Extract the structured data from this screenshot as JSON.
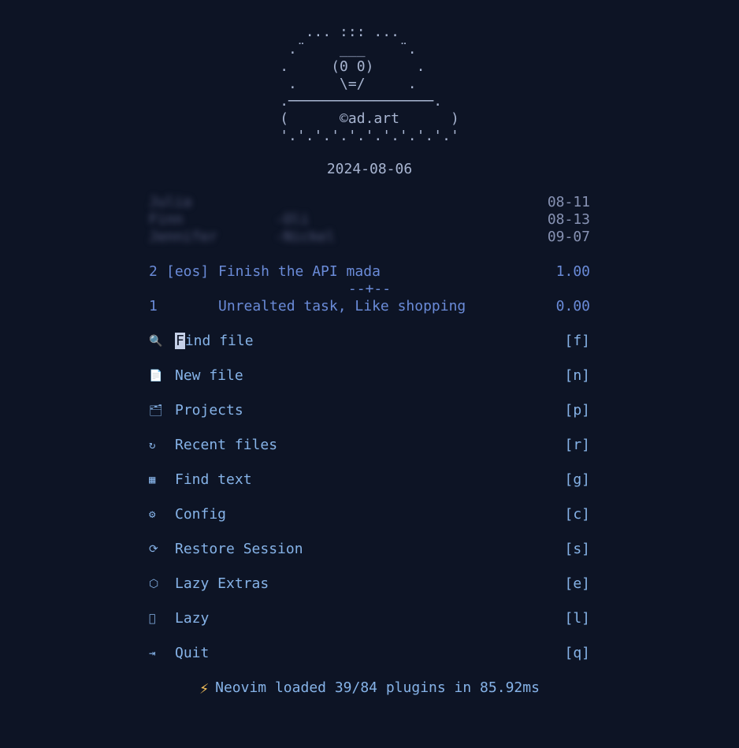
{
  "ascii": {
    "l1": "   ... ::: ...",
    "l2": " .¨    ___    ¨.",
    "l3": ".     (0 0)     .",
    "l4": " .     \\=/     .",
    "l5": ".─────────────────.",
    "l6": "(      ©ad.art      )",
    "l7": "'.'.'.'.'.'.'.'.'.'.'"
  },
  "date": "2024-08-06",
  "events": [
    {
      "name": "Julia",
      "tag": "",
      "date": "08-11"
    },
    {
      "name": "Finn",
      "tag": "-Oli",
      "date": "08-13"
    },
    {
      "name": "Jennifer",
      "tag": "-Nickel",
      "date": "09-07"
    }
  ],
  "tasks": [
    {
      "num": "2",
      "tag": "[eos]",
      "desc": "Finish the API mada",
      "val": "1.00"
    },
    {
      "sep": "--+--"
    },
    {
      "num": "1",
      "tag": "",
      "desc": "Unrealted task, Like shopping",
      "val": "0.00"
    }
  ],
  "menu": [
    {
      "icon": "🔍",
      "label": "Find file",
      "key": "[f]",
      "highlighted": true,
      "name": "find-file"
    },
    {
      "icon": "📄",
      "label": "New file",
      "key": "[n]",
      "name": "new-file"
    },
    {
      "icon": "🗂",
      "label": "Projects",
      "key": "[p]",
      "name": "projects"
    },
    {
      "icon": "↻",
      "label": "Recent files",
      "key": "[r]",
      "name": "recent-files"
    },
    {
      "icon": "▦",
      "label": "Find text",
      "key": "[g]",
      "name": "find-text"
    },
    {
      "icon": "⚙",
      "label": "Config",
      "key": "[c]",
      "name": "config"
    },
    {
      "icon": "⟳",
      "label": "Restore Session",
      "key": "[s]",
      "name": "restore-session"
    },
    {
      "icon": "⬡",
      "label": "Lazy Extras",
      "key": "[e]",
      "name": "lazy-extras"
    },
    {
      "icon": "󰒲",
      "label": "Lazy",
      "key": "[l]",
      "name": "lazy"
    },
    {
      "icon": "⇥",
      "label": "Quit",
      "key": "[q]",
      "name": "quit"
    }
  ],
  "footer": {
    "bolt": "⚡",
    "text": "Neovim loaded 39/84 plugins in 85.92ms"
  }
}
